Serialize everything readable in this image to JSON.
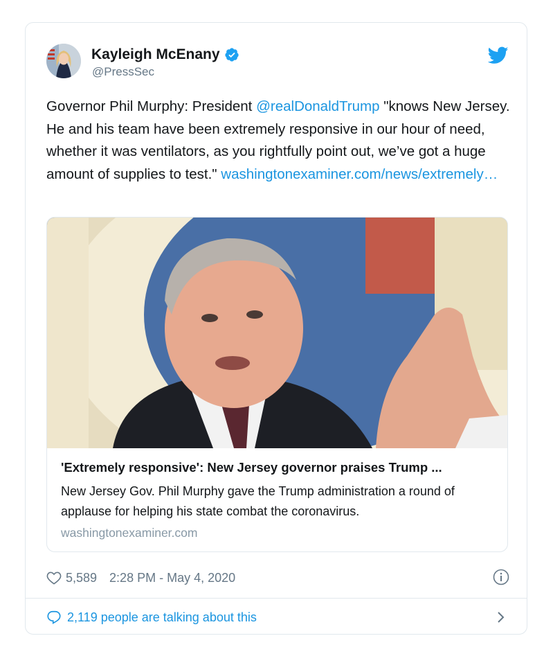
{
  "tweet": {
    "author_name": "Kayleigh McEnany",
    "author_handle": "@PressSec",
    "text": {
      "part1": "Governor Phil Murphy: President ",
      "mention": "@realDonaldTrump",
      "part2": " \"knows New Jersey. He and his team have been extremely responsive in our hour of need, whether it was ventilators, as you rightfully point out, we’ve got a huge amount of supplies to test.\" ",
      "link": "washingtonexaminer.com/news/extremely…"
    },
    "link_card": {
      "title": "'Extremely responsive': New Jersey governor praises Trump ...",
      "description": "New Jersey Gov. Phil Murphy gave the Trump administration a round of applause for helping his state combat the coronavirus.",
      "domain": "washingtonexaminer.com"
    },
    "likes": "5,589",
    "timestamp": "2:28 PM - May 4, 2020",
    "footer_text": "2,119 people are talking about this"
  },
  "colors": {
    "accent": "#1b95e0",
    "text": "#14171a",
    "muted": "#657786",
    "border": "#e1e8ed",
    "twitter_blue": "#1da1f2"
  },
  "icons": [
    "verified-badge-icon",
    "twitter-bird-icon",
    "heart-icon",
    "info-icon",
    "comment-bubble-icon",
    "chevron-right-icon"
  ]
}
